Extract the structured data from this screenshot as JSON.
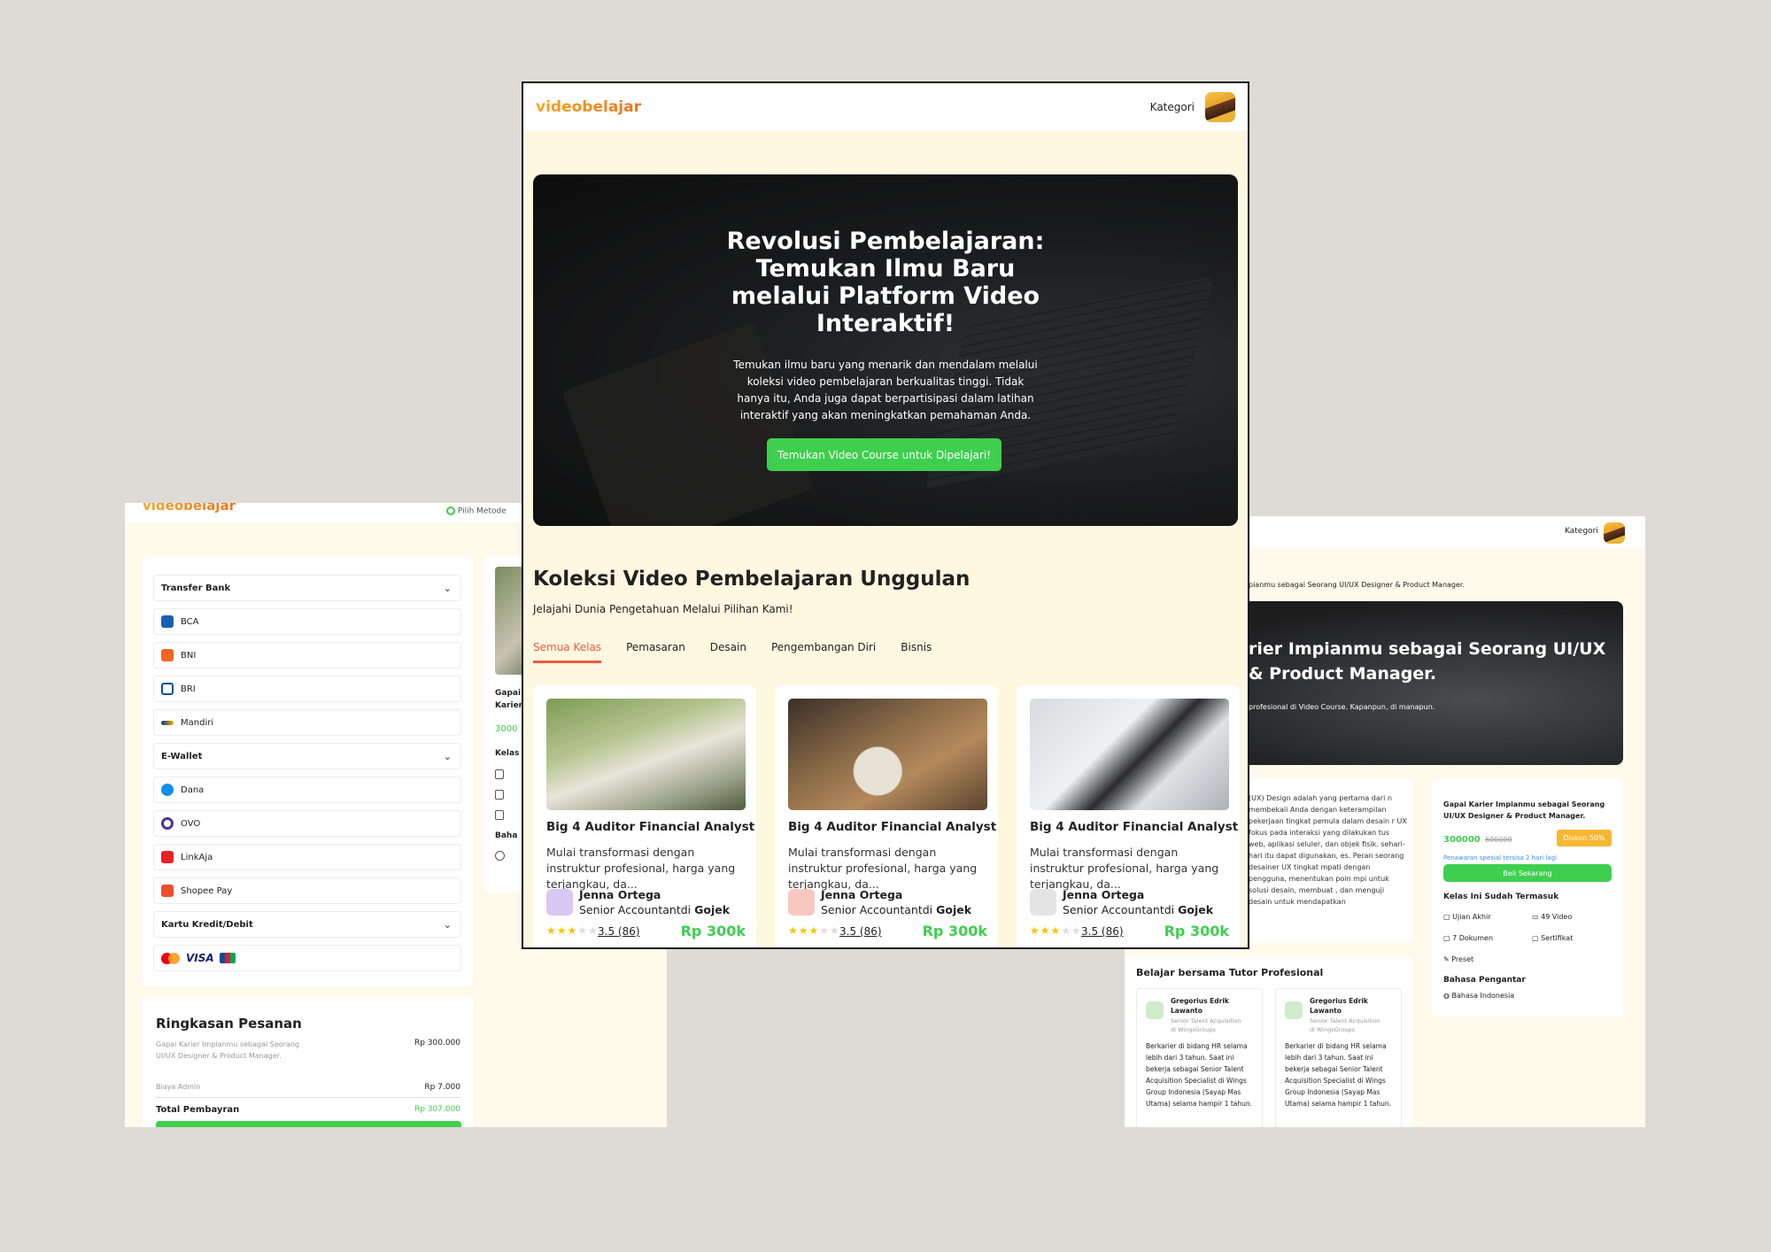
{
  "checkout": {
    "logo": "videobelajar",
    "step_label": "Pilih Metode",
    "payment": {
      "transfer_bank": "Transfer Bank",
      "banks": [
        "BCA",
        "BNI",
        "BRI",
        "Mandiri"
      ],
      "ewallet": "E-Wallet",
      "wallets": [
        "Dana",
        "OVO",
        "LinkAja",
        "Shopee Pay"
      ],
      "card": "Kartu Kredit/Debit",
      "card_brands": [
        "VISA"
      ]
    },
    "summary": {
      "title": "Ringkasan Pesanan",
      "item": "Gapai Karier Impianmu sebagai Seorang UI/UX Designer & Product Manager.",
      "item_price": "Rp 300.000",
      "admin_label": "Biaya Admin",
      "admin_price": "Rp 7.000",
      "total_label": "Total Pembayran",
      "total_price": "Rp 307.000"
    },
    "side": {
      "title": "Gapai Karier Impianmu sebagai Seorang UI/UX",
      "price": "3000",
      "label1": "Kelas",
      "label2": "Baha"
    }
  },
  "home": {
    "logo": "videobelajar",
    "nav_kategori": "Kategori",
    "hero_title": "Revolusi Pembelajaran: Temukan Ilmu Baru melalui Platform Video Interaktif!",
    "hero_text": "Temukan ilmu baru yang menarik dan mendalam melalui koleksi video pembelajaran berkualitas tinggi. Tidak hanya itu, Anda juga dapat berpartisipasi dalam latihan interaktif yang akan meningkatkan pemahaman Anda.",
    "hero_button": "Temukan Video Course untuk Dipelajari!",
    "section_title": "Koleksi Video Pembelajaran Unggulan",
    "section_sub": "Jelajahi Dunia Pengetahuan Melalui Pilihan Kami!",
    "tabs": [
      "Semua Kelas",
      "Pemasaran",
      "Desain",
      "Pengembangan Diri",
      "Bisnis"
    ],
    "cards": [
      {
        "title": "Big 4 Auditor Financial Analyst",
        "desc": "Mulai transformasi dengan instruktur profesional, harga yang terjangkau, da...",
        "tutor": "Jenna Ortega",
        "role": "Senior Accountantdi ",
        "company": "Gojek",
        "rating": "3.5 (86)",
        "price": "Rp 300k"
      },
      {
        "title": "Big 4 Auditor Financial Analyst",
        "desc": "Mulai transformasi dengan instruktur profesional, harga yang terjangkau, da...",
        "tutor": "Jenna Ortega",
        "role": "Senior Accountantdi ",
        "company": "Gojek",
        "rating": "3.5 (86)",
        "price": "Rp 300k"
      },
      {
        "title": "Big 4 Auditor Financial Analyst",
        "desc": "Mulai transformasi dengan instruktur profesional, harga yang terjangkau, da...",
        "tutor": "Jenna Ortega",
        "role": "Senior Accountantdi ",
        "company": "Gojek",
        "rating": "3.5 (86)",
        "price": "Rp 300k"
      }
    ]
  },
  "detail": {
    "nav_kategori": "Kategori",
    "breadcrumb": "pianmu sebagai Seorang UI/UX Designer & Product Manager.",
    "hero_title_1": "rier Impianmu sebagai Seorang UI/UX",
    "hero_title_2": "& Product Manager.",
    "hero_text": "profesional di Video Course. Kapanpun, di manapun.",
    "desc": "(UX) Design adalah yang pertama dari n membekali Anda dengan keterampilan pekerjaan tingkat pemula dalam desain r UX fokus pada interaksi yang dilakukan tus web, aplikasi seluler, dan objek fisik. sehari-hari itu dapat digunakan, es. Peran seorang desainer UX tingkat mpati dengan pengguna, menentukan poin mpi untuk solusi desain, membuat , dan menguji desain untuk mendapatkan",
    "buy": {
      "title": "Gapai Karier Impianmu sebagai Seorang UI/UX Designer & Product Manager.",
      "price": "300000",
      "old_price": "600000",
      "discount": "Diskon 50%",
      "offer": "Penawaran spesial tersisa 2 hari lagi",
      "button": "Beli Sekarang",
      "includes_title": "Kelas Ini Sudah Termasuk",
      "includes": [
        "Ujian Akhir",
        "49 Video",
        "7 Dokumen",
        "Sertifikat",
        "Preset"
      ],
      "lang_title": "Bahasa Pengantar",
      "lang": "Bahasa Indonesia"
    },
    "tutor_section": "Belajar bersama Tutor Profesional",
    "tutors": [
      {
        "name": "Gregorius Edrik Lawanto",
        "role": "Senior Talent Acquisition",
        "company_prefix": "di ",
        "company": "WingsGroups",
        "bio": "Berkarier di bidang HR selama lebih dari 3 tahun. Saat ini bekerja sebagai Senior Talent Acquisition Specialist di Wings Group Indonesia (Sayap Mas Utama) selama hampir 1 tahun."
      },
      {
        "name": "Gregorius Edrik Lawanto",
        "role": "Senior Talent Acquisition",
        "company_prefix": "di ",
        "company": "WingsGroups",
        "bio": "Berkarier di bidang HR selama lebih dari 3 tahun. Saat ini bekerja sebagai Senior Talent Acquisition Specialist di Wings Group Indonesia (Sayap Mas Utama) selama hampir 1 tahun."
      }
    ]
  },
  "colors": {
    "accent": "#3ecf4f",
    "brand": "#f5a623",
    "tab_active": "#f05a3e",
    "bg": "#fffaec"
  }
}
